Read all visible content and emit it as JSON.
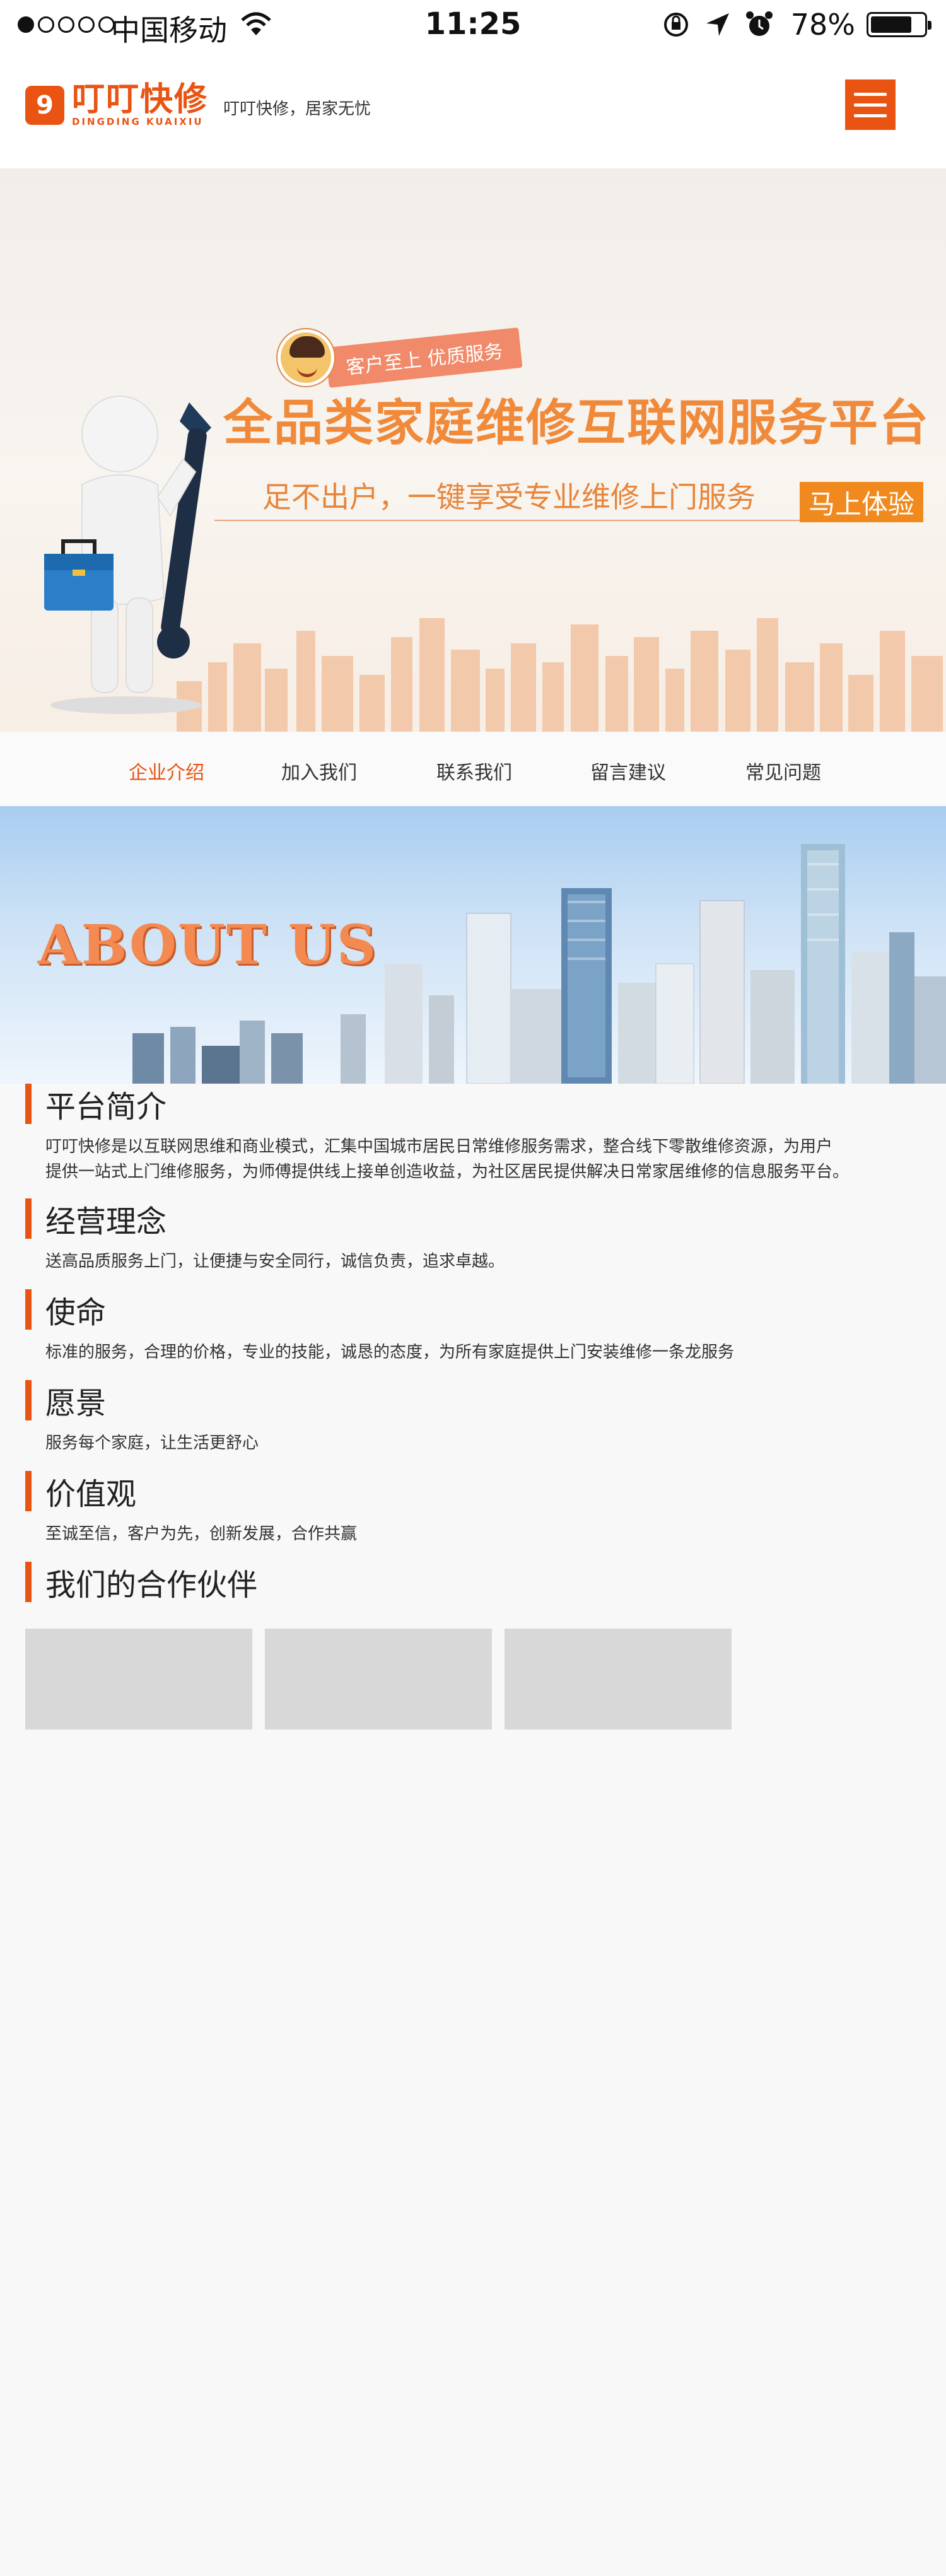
{
  "statusbar": {
    "carrier": "中国移动",
    "time": "11:25",
    "battery_pct": "78%",
    "battery_level": 0.78
  },
  "header": {
    "logo_name": "叮叮快修",
    "logo_sub": "DINGDING KUAIXIU",
    "slogan": "叮叮快修，居家无忧"
  },
  "banner": {
    "badge": "客户至上 优质服务",
    "title": "全品类家庭维修互联网服务平台",
    "subtitle": "足不出户，一键享受专业维修上门服务",
    "cta": "马上体验"
  },
  "nav": {
    "tabs": [
      {
        "label": "企业介绍",
        "active": true
      },
      {
        "label": "加入我们",
        "active": false
      },
      {
        "label": "联系我们",
        "active": false
      },
      {
        "label": "留言建议",
        "active": false
      },
      {
        "label": "常见问题",
        "active": false
      }
    ]
  },
  "about": {
    "title": "ABOUT US"
  },
  "sections": [
    {
      "title": "平台简介",
      "lines": [
        "叮叮快修是以互联网思维和商业模式，汇集中国城市居民日常维修服务需求，整合线下零散维修资源，为用户",
        "提供一站式上门维修服务，为师傅提供线上接单创造收益，为社区居民提供解决日常家居维修的信息服务平台。"
      ]
    },
    {
      "title": "经营理念",
      "lines": [
        "送高品质服务上门，让便捷与安全同行，诚信负责，追求卓越。"
      ]
    },
    {
      "title": "使命",
      "lines": [
        "标准的服务，合理的价格，专业的技能，诚恳的态度，为所有家庭提供上门安装维修一条龙服务"
      ]
    },
    {
      "title": "愿景",
      "lines": [
        "服务每个家庭，让生活更舒心"
      ]
    },
    {
      "title": "价值观",
      "lines": [
        "至诚至信，客户为先，创新发展，合作共赢"
      ]
    },
    {
      "title": "我们的合作伙伴",
      "lines": []
    }
  ],
  "colors": {
    "brand": "#ea5413",
    "banner_title": "#f08a3a",
    "cta": "#f08a1e"
  },
  "icons": [
    "wifi-icon",
    "rotation-lock-icon",
    "location-icon",
    "alarm-icon",
    "battery-icon",
    "menu-icon",
    "wrench-icon",
    "toolbox-icon"
  ]
}
